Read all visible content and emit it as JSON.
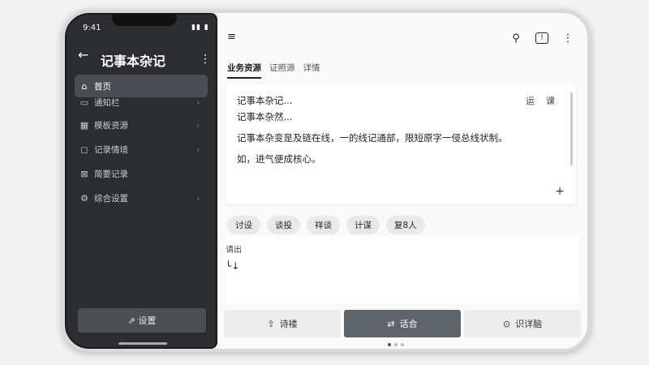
{
  "phone": {
    "status_time": "9:41",
    "status_icons": "▮▮ ▮",
    "back_icon": "←",
    "title": "记事本杂记",
    "more_icon": "⋮",
    "nav": [
      {
        "label": "首页",
        "icon": "⌂",
        "active": true
      },
      {
        "label": "通知栏",
        "icon": "▭",
        "active": false
      },
      {
        "label": "模板资源",
        "icon": "▦",
        "active": false
      },
      {
        "label": "记录情境",
        "icon": "◻",
        "active": false
      },
      {
        "label": "简要记录",
        "icon": "⊠",
        "active": false
      },
      {
        "label": "综合设置",
        "icon": "⚙",
        "active": false
      }
    ],
    "chevron": "›",
    "bottom_button": "⇗ 设置"
  },
  "tablet": {
    "menu_icon": "≡",
    "top_icons": {
      "search": "⚲",
      "info": "!",
      "more": "⋮"
    },
    "tabs": [
      {
        "label": "业务资源",
        "active": true
      },
      {
        "label": "证照源",
        "active": false
      },
      {
        "label": "详情",
        "active": false
      }
    ],
    "editor": {
      "lines": [
        "记事本杂记...",
        "记事本杂然...",
        "记事本杂变是及链在线，一的线记通部，限短原字一侵总线状制。",
        "如，进气便成核心。"
      ],
      "actions": [
        "运",
        "课"
      ],
      "plus_icon": "+"
    },
    "chips": [
      "讨设",
      "谈投",
      "祥谈",
      "计谋",
      "复8人"
    ],
    "field": {
      "label": "请出",
      "value": "└↓"
    },
    "actions": [
      {
        "label": "诗褛",
        "icon": "⇧",
        "style": "light"
      },
      {
        "label": "话合",
        "icon": "⇄",
        "style": "primary"
      },
      {
        "label": "识详脑",
        "icon": "⊙",
        "style": "light"
      }
    ]
  }
}
